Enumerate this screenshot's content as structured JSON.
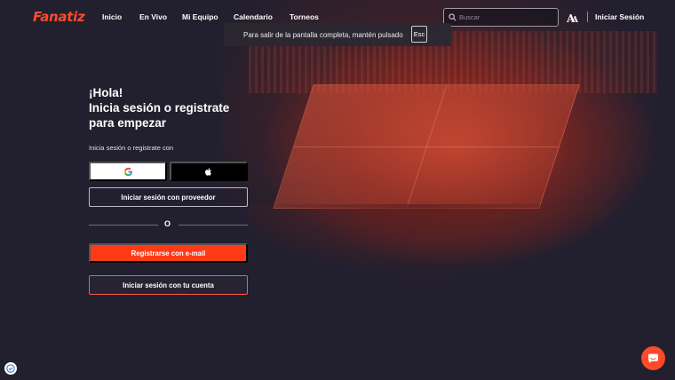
{
  "brand": {
    "logo_text": "Fanatiz",
    "accent": "#ff3b17"
  },
  "nav": {
    "items": [
      {
        "label": "Inicio"
      },
      {
        "label": "En Vivo"
      },
      {
        "label": "Mi Equipo"
      },
      {
        "label": "Calendario"
      },
      {
        "label": "Torneos"
      }
    ],
    "search_placeholder": "Buscar",
    "partner_logo_text": "AFA",
    "login_label": "Iniciar Sesión"
  },
  "fullscreen_notice": {
    "text": "Para salir de la pantalla completa, mantén pulsado",
    "key": "Esc"
  },
  "auth": {
    "greeting_line1": "¡Hola!",
    "greeting_line2": "Inicia sesión o registrate",
    "greeting_line3": "para empezar",
    "subtitle": "Inicia sesión o registrate con",
    "google_icon": "google-icon",
    "apple_icon": "apple-icon",
    "provider_label": "Iniciar sesión con proveedor",
    "divider_text": "O",
    "email_label": "Registrarse con e-mail",
    "account_label": "Iniciar sesión con tu cuenta"
  },
  "widgets": {
    "chat_icon": "chat-icon",
    "badge_icon": "shield-check-icon"
  }
}
